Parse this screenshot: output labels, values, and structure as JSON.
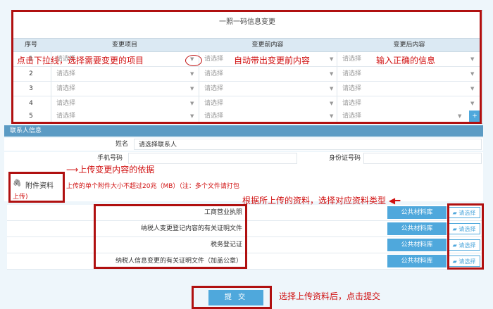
{
  "form": {
    "title": "一照一码信息变更",
    "headers": [
      "序号",
      "变更项目",
      "变更前内容",
      "变更后内容"
    ],
    "placeholder": "请选择",
    "add_symbol": "+",
    "rows": [
      "1",
      "2",
      "3",
      "4",
      "5"
    ]
  },
  "contact": {
    "section_title": "联系人信息",
    "name_label": "姓名",
    "name_value": "请选择联系人",
    "phone_label": "手机号码",
    "id_label": "身份证号码"
  },
  "attachment": {
    "label": "附件资料",
    "label2": "上传)",
    "note": "上传的单个附件大小不超过20兆（MB）（注：多个文件请打包"
  },
  "documents": [
    {
      "name": "工商营业执照",
      "lib": "公共材料库",
      "pick": "请选择"
    },
    {
      "name": "纳税人变更登记内容的有关证明文件",
      "lib": "公共材料库",
      "pick": "请选择"
    },
    {
      "name": "税务登记证",
      "lib": "公共材料库",
      "pick": "请选择"
    },
    {
      "name": "纳税人信息变更的有关证明文件（加盖公章）",
      "lib": "公共材料库",
      "pick": "请选择"
    }
  ],
  "submit_label": "提 交",
  "annotations": {
    "a1": "点击下拉线，选择需要变更的项目",
    "a2": "自动带出变更前内容",
    "a3": "输入正确的信息",
    "a4": "上传变更内容的依据",
    "a5": "根据所上传的资料，选择对应资料类型",
    "a6": "选择上传资料后，点击提交"
  },
  "colors": {
    "accent": "#4fa8dc",
    "annotation": "#d01010",
    "section": "#5b9bc4"
  }
}
